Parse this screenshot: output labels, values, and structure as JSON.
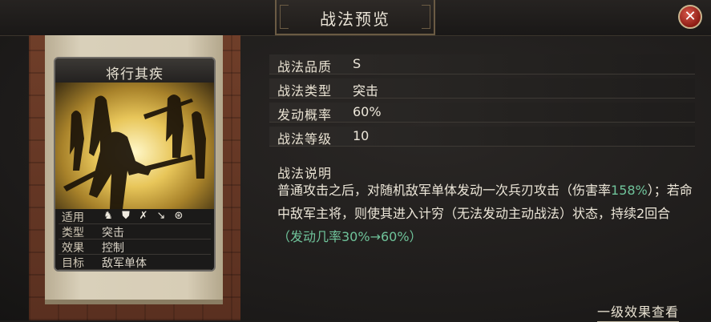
{
  "header": {
    "title": "战法预览",
    "close_label": "✕"
  },
  "card": {
    "name": "将行其疾",
    "troop_icons": [
      "cavalry-icon",
      "shield-icon",
      "bow-icon",
      "spear-icon",
      "chariot-icon"
    ],
    "rows": [
      {
        "key": "适用",
        "value": ""
      },
      {
        "key": "类型",
        "value": "突击"
      },
      {
        "key": "效果",
        "value": "控制"
      },
      {
        "key": "目标",
        "value": "敌军单体"
      }
    ]
  },
  "attributes": [
    {
      "key": "战法品质",
      "value": "S"
    },
    {
      "key": "战法类型",
      "value": "突击"
    },
    {
      "key": "发动概率",
      "value": "60%"
    },
    {
      "key": "战法等级",
      "value": "10"
    }
  ],
  "description": {
    "title": "战法说明",
    "part1": "普通攻击之后，对随机敌军单体发动一次兵刃攻击（伤害率",
    "rate": "158%",
    "part2": "）；若命中敌军主将，则使其进入计穷（无法发动主动战法）状态，持续2回合",
    "chance": "（发动几率30%→60%）"
  },
  "footer": {
    "more_label": "一级效果查看"
  },
  "colors": {
    "highlight_green": "#6fc39a",
    "close_red": "#b4322a"
  }
}
